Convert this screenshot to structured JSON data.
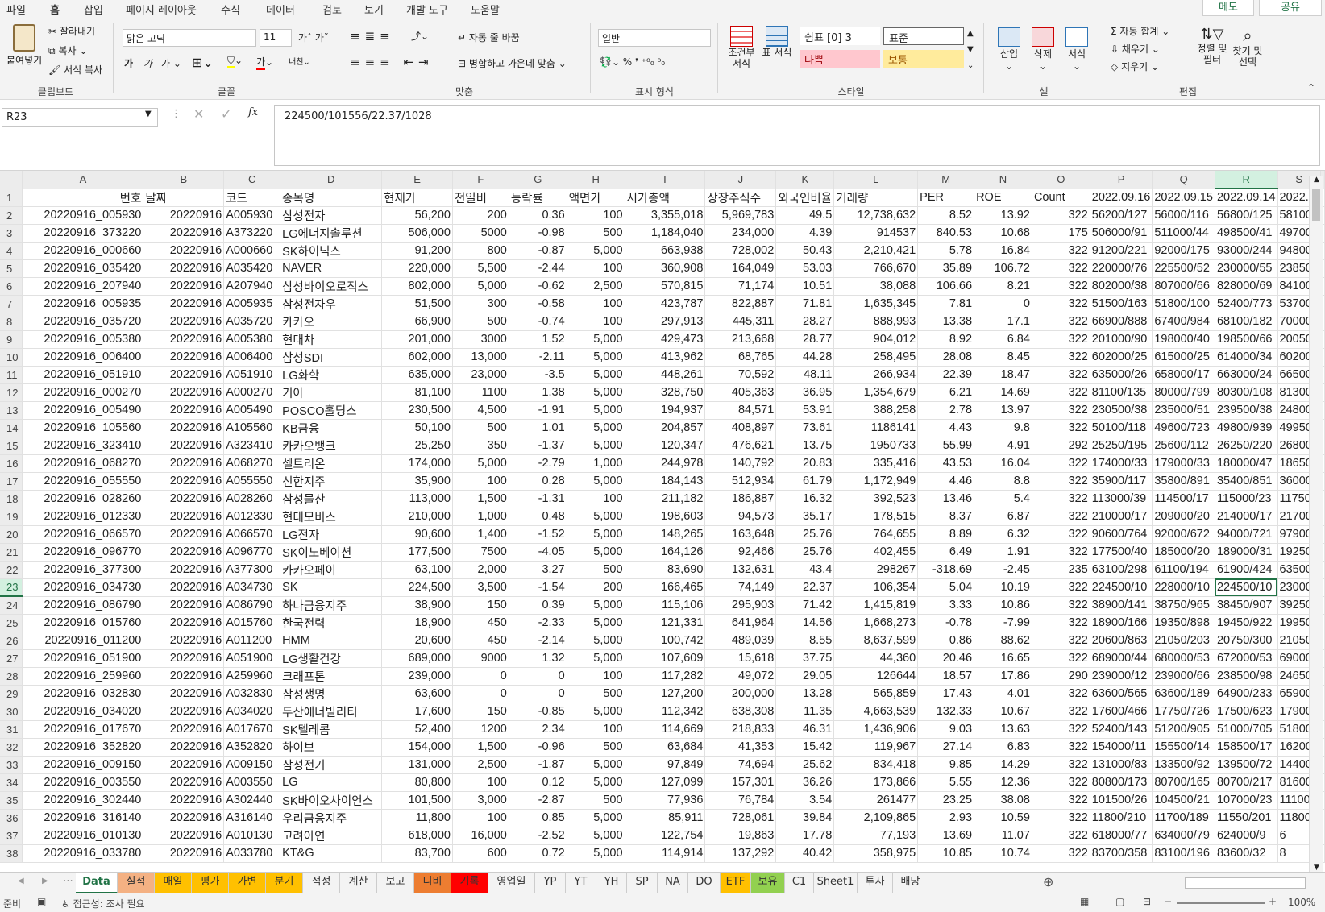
{
  "menu": {
    "tabs": [
      "파일",
      "홈",
      "삽입",
      "페이지 레이아웃",
      "수식",
      "데이터",
      "검토",
      "보기",
      "개발 도구",
      "도움말"
    ],
    "active": "홈",
    "memo": "메모",
    "share": "공유"
  },
  "ribbon": {
    "clipboard": {
      "paste": "붙여넣기",
      "cut": "잘라내기",
      "copy": "복사",
      "format_painter": "서식 복사",
      "label": "클립보드"
    },
    "font": {
      "name": "맑은 고딕",
      "size": "11",
      "label": "글꼴"
    },
    "alignment": {
      "wrap": "자동 줄 바꿈",
      "merge": "병합하고 가운데 맞춤",
      "label": "맞춤"
    },
    "number": {
      "format": "일반",
      "label": "표시 형식"
    },
    "styles": {
      "conditional": "조건부 서식",
      "table": "표 서식",
      "cell_style": "쉼표 [0] 3",
      "normal": "표준",
      "bad": "나쁨",
      "neutral": "보통",
      "label": "스타일"
    },
    "cells": {
      "insert": "삽입",
      "delete": "삭제",
      "format": "서식",
      "label": "셀"
    },
    "editing": {
      "autosum": "자동 합계",
      "fill": "채우기",
      "clear": "지우기",
      "sort": "정렬 및 필터",
      "find": "찾기 및 선택",
      "label": "편집"
    }
  },
  "formula_bar": {
    "name_box": "R23",
    "formula": "224500/101556/22.37/1028"
  },
  "grid": {
    "columns": [
      "A",
      "B",
      "C",
      "D",
      "E",
      "F",
      "G",
      "H",
      "I",
      "J",
      "K",
      "L",
      "M",
      "N",
      "O",
      "P",
      "Q",
      "R",
      "S"
    ],
    "selected_column": "R",
    "selected_row": 23,
    "header_row": [
      "번호",
      "날짜",
      "코드",
      "종목명",
      "현재가",
      "전일비",
      "등락률",
      "액면가",
      "시가총액",
      "상장주식수",
      "외국인비율",
      "거래량",
      "PER",
      "ROE",
      "Count",
      "2022.09.16",
      "2022.09.15",
      "2022.09.14",
      "2022.0"
    ],
    "rows": [
      [
        "20220916_005930",
        "20220916",
        "A005930",
        "삼성전자",
        "56,200",
        "200",
        "0.36",
        "100",
        "3,355,018",
        "5,969,783",
        "49.5",
        "12,738,632",
        "8.52",
        "13.92",
        "322",
        "56200/127",
        "56000/116",
        "56800/125",
        "58100/"
      ],
      [
        "20220916_373220",
        "20220916",
        "A373220",
        "LG에너지솔루션",
        "506,000",
        "5000",
        "-0.98",
        "500",
        "1,184,040",
        "234,000",
        "4.39",
        "914537",
        "840.53",
        "10.68",
        "175",
        "506000/91",
        "511000/44",
        "498500/41",
        "497000"
      ],
      [
        "20220916_000660",
        "20220916",
        "A000660",
        "SK하이닉스",
        "91,200",
        "800",
        "-0.87",
        "5,000",
        "663,938",
        "728,002",
        "50.43",
        "2,210,421",
        "5.78",
        "16.84",
        "322",
        "91200/221",
        "92000/175",
        "93000/244",
        "94800/"
      ],
      [
        "20220916_035420",
        "20220916",
        "A035420",
        "NAVER",
        "220,000",
        "5,500",
        "-2.44",
        "100",
        "360,908",
        "164,049",
        "53.03",
        "766,670",
        "35.89",
        "106.72",
        "322",
        "220000/76",
        "225500/52",
        "230000/55",
        "238500"
      ],
      [
        "20220916_207940",
        "20220916",
        "A207940",
        "삼성바이오로직스",
        "802,000",
        "5,000",
        "-0.62",
        "2,500",
        "570,815",
        "71,174",
        "10.51",
        "38,088",
        "106.66",
        "8.21",
        "322",
        "802000/38",
        "807000/66",
        "828000/69",
        "841000"
      ],
      [
        "20220916_005935",
        "20220916",
        "A005935",
        "삼성전자우",
        "51,500",
        "300",
        "-0.58",
        "100",
        "423,787",
        "822,887",
        "71.81",
        "1,635,345",
        "7.81",
        "0",
        "322",
        "51500/163",
        "51800/100",
        "52400/773",
        "53700/"
      ],
      [
        "20220916_035720",
        "20220916",
        "A035720",
        "카카오",
        "66,900",
        "500",
        "-0.74",
        "100",
        "297,913",
        "445,311",
        "28.27",
        "888,993",
        "13.38",
        "17.1",
        "322",
        "66900/888",
        "67400/984",
        "68100/182",
        "70000/"
      ],
      [
        "20220916_005380",
        "20220916",
        "A005380",
        "현대차",
        "201,000",
        "3000",
        "1.52",
        "5,000",
        "429,473",
        "213,668",
        "28.77",
        "904,012",
        "8.92",
        "6.84",
        "322",
        "201000/90",
        "198000/40",
        "198500/66",
        "200500"
      ],
      [
        "20220916_006400",
        "20220916",
        "A006400",
        "삼성SDI",
        "602,000",
        "13,000",
        "-2.11",
        "5,000",
        "413,962",
        "68,765",
        "44.28",
        "258,495",
        "28.08",
        "8.45",
        "322",
        "602000/25",
        "615000/25",
        "614000/34",
        "602000"
      ],
      [
        "20220916_051910",
        "20220916",
        "A051910",
        "LG화학",
        "635,000",
        "23,000",
        "-3.5",
        "5,000",
        "448,261",
        "70,592",
        "48.11",
        "266,934",
        "22.39",
        "18.47",
        "322",
        "635000/26",
        "658000/17",
        "663000/24",
        "665000"
      ],
      [
        "20220916_000270",
        "20220916",
        "A000270",
        "기아",
        "81,100",
        "1100",
        "1.38",
        "5,000",
        "328,750",
        "405,363",
        "36.95",
        "1,354,679",
        "6.21",
        "14.69",
        "322",
        "81100/135",
        "80000/799",
        "80300/108",
        "81300/"
      ],
      [
        "20220916_005490",
        "20220916",
        "A005490",
        "POSCO홀딩스",
        "230,500",
        "4,500",
        "-1.91",
        "5,000",
        "194,937",
        "84,571",
        "53.91",
        "388,258",
        "2.78",
        "13.97",
        "322",
        "230500/38",
        "235000/51",
        "239500/38",
        "248000"
      ],
      [
        "20220916_105560",
        "20220916",
        "A105560",
        "KB금융",
        "50,100",
        "500",
        "1.01",
        "5,000",
        "204,857",
        "408,897",
        "73.61",
        "1186141",
        "4.43",
        "9.8",
        "322",
        "50100/118",
        "49600/723",
        "49800/939",
        "49950/"
      ],
      [
        "20220916_323410",
        "20220916",
        "A323410",
        "카카오뱅크",
        "25,250",
        "350",
        "-1.37",
        "5,000",
        "120,347",
        "476,621",
        "13.75",
        "1950733",
        "55.99",
        "4.91",
        "292",
        "25250/195",
        "25600/112",
        "26250/220",
        "26800/"
      ],
      [
        "20220916_068270",
        "20220916",
        "A068270",
        "셀트리온",
        "174,000",
        "5,000",
        "-2.79",
        "1,000",
        "244,978",
        "140,792",
        "20.83",
        "335,416",
        "43.53",
        "16.04",
        "322",
        "174000/33",
        "179000/33",
        "180000/47",
        "186500"
      ],
      [
        "20220916_055550",
        "20220916",
        "A055550",
        "신한지주",
        "35,900",
        "100",
        "0.28",
        "5,000",
        "184,143",
        "512,934",
        "61.79",
        "1,172,949",
        "4.46",
        "8.8",
        "322",
        "35900/117",
        "35800/891",
        "35400/851",
        "36000/"
      ],
      [
        "20220916_028260",
        "20220916",
        "A028260",
        "삼성물산",
        "113,000",
        "1,500",
        "-1.31",
        "100",
        "211,182",
        "186,887",
        "16.32",
        "392,523",
        "13.46",
        "5.4",
        "322",
        "113000/39",
        "114500/17",
        "115000/23",
        "117500"
      ],
      [
        "20220916_012330",
        "20220916",
        "A012330",
        "현대모비스",
        "210,000",
        "1,000",
        "0.48",
        "5,000",
        "198,603",
        "94,573",
        "35.17",
        "178,515",
        "8.37",
        "6.87",
        "322",
        "210000/17",
        "209000/20",
        "214000/17",
        "217000"
      ],
      [
        "20220916_066570",
        "20220916",
        "A066570",
        "LG전자",
        "90,600",
        "1,400",
        "-1.52",
        "5,000",
        "148,265",
        "163,648",
        "25.76",
        "764,655",
        "8.89",
        "6.32",
        "322",
        "90600/764",
        "92000/672",
        "94000/721",
        "97900/"
      ],
      [
        "20220916_096770",
        "20220916",
        "A096770",
        "SK이노베이션",
        "177,500",
        "7500",
        "-4.05",
        "5,000",
        "164,126",
        "92,466",
        "25.76",
        "402,455",
        "6.49",
        "1.91",
        "322",
        "177500/40",
        "185000/20",
        "189000/31",
        "192500"
      ],
      [
        "20220916_377300",
        "20220916",
        "A377300",
        "카카오페이",
        "63,100",
        "2,000",
        "3.27",
        "500",
        "83,690",
        "132,631",
        "43.4",
        "298267",
        "-318.69",
        "-2.45",
        "235",
        "63100/298",
        "61100/194",
        "61900/424",
        "63500/"
      ],
      [
        "20220916_034730",
        "20220916",
        "A034730",
        "SK",
        "224,500",
        "3,500",
        "-1.54",
        "200",
        "166,465",
        "74,149",
        "22.37",
        "106,354",
        "5.04",
        "10.19",
        "322",
        "224500/10",
        "228000/10",
        "224500/10",
        "230000"
      ],
      [
        "20220916_086790",
        "20220916",
        "A086790",
        "하나금융지주",
        "38,900",
        "150",
        "0.39",
        "5,000",
        "115,106",
        "295,903",
        "71.42",
        "1,415,819",
        "3.33",
        "10.86",
        "322",
        "38900/141",
        "38750/965",
        "38450/907",
        "39250/"
      ],
      [
        "20220916_015760",
        "20220916",
        "A015760",
        "한국전력",
        "18,900",
        "450",
        "-2.33",
        "5,000",
        "121,331",
        "641,964",
        "14.56",
        "1,668,273",
        "-0.78",
        "-7.99",
        "322",
        "18900/166",
        "19350/898",
        "19450/922",
        "19950/"
      ],
      [
        "20220916_011200",
        "20220916",
        "A011200",
        "HMM",
        "20,600",
        "450",
        "-2.14",
        "5,000",
        "100,742",
        "489,039",
        "8.55",
        "8,637,599",
        "0.86",
        "88.62",
        "322",
        "20600/863",
        "21050/203",
        "20750/300",
        "21050/"
      ],
      [
        "20220916_051900",
        "20220916",
        "A051900",
        "LG생활건강",
        "689,000",
        "9000",
        "1.32",
        "5,000",
        "107,609",
        "15,618",
        "37.75",
        "44,360",
        "20.46",
        "16.65",
        "322",
        "689000/44",
        "680000/53",
        "672000/53",
        "690000"
      ],
      [
        "20220916_259960",
        "20220916",
        "A259960",
        "크래프톤",
        "239,000",
        "0",
        "0",
        "100",
        "117,282",
        "49,072",
        "29.05",
        "126644",
        "18.57",
        "17.86",
        "290",
        "239000/12",
        "239000/66",
        "238500/98",
        "246500"
      ],
      [
        "20220916_032830",
        "20220916",
        "A032830",
        "삼성생명",
        "63,600",
        "0",
        "0",
        "500",
        "127,200",
        "200,000",
        "13.28",
        "565,859",
        "17.43",
        "4.01",
        "322",
        "63600/565",
        "63600/189",
        "64900/233",
        "65900/"
      ],
      [
        "20220916_034020",
        "20220916",
        "A034020",
        "두산에너빌리티",
        "17,600",
        "150",
        "-0.85",
        "5,000",
        "112,342",
        "638,308",
        "11.35",
        "4,663,539",
        "132.33",
        "10.67",
        "322",
        "17600/466",
        "17750/726",
        "17500/623",
        "17900/"
      ],
      [
        "20220916_017670",
        "20220916",
        "A017670",
        "SK텔레콤",
        "52,400",
        "1200",
        "2.34",
        "100",
        "114,669",
        "218,833",
        "46.31",
        "1,436,906",
        "9.03",
        "13.63",
        "322",
        "52400/143",
        "51200/905",
        "51000/705",
        "51800/"
      ],
      [
        "20220916_352820",
        "20220916",
        "A352820",
        "하이브",
        "154,000",
        "1,500",
        "-0.96",
        "500",
        "63,684",
        "41,353",
        "15.42",
        "119,967",
        "27.14",
        "6.83",
        "322",
        "154000/11",
        "155500/14",
        "158500/17",
        "162000"
      ],
      [
        "20220916_009150",
        "20220916",
        "A009150",
        "삼성전기",
        "131,000",
        "2,500",
        "-1.87",
        "5,000",
        "97,849",
        "74,694",
        "25.62",
        "834,418",
        "9.85",
        "14.29",
        "322",
        "131000/83",
        "133500/92",
        "139500/72",
        "144000"
      ],
      [
        "20220916_003550",
        "20220916",
        "A003550",
        "LG",
        "80,800",
        "100",
        "0.12",
        "5,000",
        "127,099",
        "157,301",
        "36.26",
        "173,866",
        "5.55",
        "12.36",
        "322",
        "80800/173",
        "80700/165",
        "80700/217",
        "81600/"
      ],
      [
        "20220916_302440",
        "20220916",
        "A302440",
        "SK바이오사이언스",
        "101,500",
        "3,000",
        "-2.87",
        "500",
        "77,936",
        "76,784",
        "3.54",
        "261477",
        "23.25",
        "38.08",
        "322",
        "101500/26",
        "104500/21",
        "107000/23",
        "111000"
      ],
      [
        "20220916_316140",
        "20220916",
        "A316140",
        "우리금융지주",
        "11,800",
        "100",
        "0.85",
        "5,000",
        "85,911",
        "728,061",
        "39.84",
        "2,109,865",
        "2.93",
        "10.59",
        "322",
        "11800/210",
        "11700/189",
        "11550/201",
        "11800/"
      ],
      [
        "20220916_010130",
        "20220916",
        "A010130",
        "고려아연",
        "618,000",
        "16,000",
        "-2.52",
        "5,000",
        "122,754",
        "19,863",
        "17.78",
        "77,193",
        "13.69",
        "11.07",
        "322",
        "618000/77",
        "634000/79",
        "624000/9",
        "6"
      ],
      [
        "20220916_033780",
        "20220916",
        "A033780",
        "KT&G",
        "83,700",
        "600",
        "0.72",
        "5,000",
        "114,914",
        "137,292",
        "40.42",
        "358,975",
        "10.85",
        "10.74",
        "322",
        "83700/358",
        "83100/196",
        "83600/32",
        "8"
      ]
    ]
  },
  "sheets": {
    "tabs": [
      {
        "name": "Data",
        "color": "#ffffff"
      },
      {
        "name": "실적",
        "color": "#f4b183"
      },
      {
        "name": "매일",
        "color": "#ffc000"
      },
      {
        "name": "평가",
        "color": "#ffc000"
      },
      {
        "name": "가변",
        "color": "#ffc000"
      },
      {
        "name": "분기",
        "color": "#ffc000"
      },
      {
        "name": "적정",
        "color": ""
      },
      {
        "name": "계산",
        "color": ""
      },
      {
        "name": "보고",
        "color": ""
      },
      {
        "name": "디비",
        "color": "#ed7d31"
      },
      {
        "name": "기록",
        "color": "#ff0000"
      },
      {
        "name": "영업일",
        "color": ""
      },
      {
        "name": "YP",
        "color": ""
      },
      {
        "name": "YT",
        "color": ""
      },
      {
        "name": "YH",
        "color": ""
      },
      {
        "name": "SP",
        "color": ""
      },
      {
        "name": "NA",
        "color": ""
      },
      {
        "name": "DO",
        "color": ""
      },
      {
        "name": "ETF",
        "color": "#ffc000"
      },
      {
        "name": "보유",
        "color": "#92d050"
      },
      {
        "name": "C1",
        "color": ""
      },
      {
        "name": "Sheet1",
        "color": ""
      },
      {
        "name": "투자",
        "color": ""
      },
      {
        "name": "배당",
        "color": ""
      }
    ],
    "active": "Data"
  },
  "status": {
    "ready": "준비",
    "accessibility": "접근성: 조사 필요",
    "zoom": "100%"
  }
}
